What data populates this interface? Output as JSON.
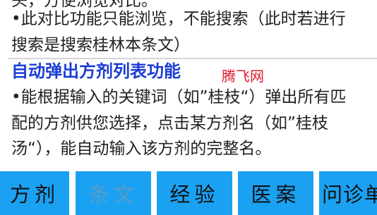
{
  "content": {
    "lines_top": [
      "头，方便浏览对比。",
      "•此对比功能只能浏览，不能搜索（此时若进行",
      "搜索是搜索桂林本条文）"
    ],
    "section_title": "自动弹出方剂列表功能",
    "watermark": "腾飞网",
    "lines_bottom": [
      "•能根据输入的关键词（如”桂枝“）弹出所有匹",
      "配的方剂供您选择，点击某方剂名（如”桂枝",
      "汤“），能自动输入该方剂的完整名。"
    ]
  },
  "tabs": [
    {
      "label": "方剂",
      "enabled": true
    },
    {
      "label": "条文",
      "enabled": false
    },
    {
      "label": "经验",
      "enabled": true
    },
    {
      "label": "医案",
      "enabled": true
    },
    {
      "label": "问诊单",
      "enabled": true
    }
  ],
  "colors": {
    "tab_background": "#1ba1f2",
    "section_title": "#1a3cd4",
    "watermark": "#e0192b",
    "disabled_tab_text": "#5a9cc6"
  }
}
